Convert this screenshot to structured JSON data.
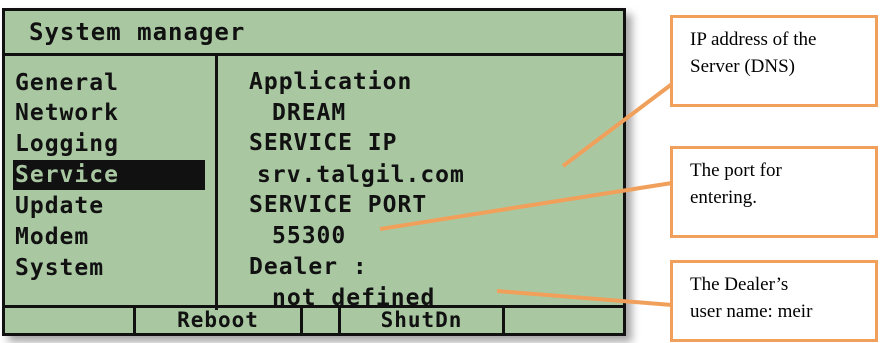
{
  "title": "System manager",
  "menu": {
    "items": [
      "General",
      "Network",
      "Logging",
      "Service",
      "Update",
      "Modem",
      "System"
    ],
    "selected": "Service"
  },
  "content": {
    "lines": [
      "Application",
      "DREAM",
      "SERVICE IP",
      "srv.talgil.com",
      "SERVICE PORT",
      "55300",
      "Dealer :",
      "not defined"
    ]
  },
  "softkeys": [
    "",
    "Reboot",
    "",
    "ShutDn",
    ""
  ],
  "callouts": [
    {
      "line1": "IP address of the",
      "line2": "Server (DNS)"
    },
    {
      "line1": "The port for",
      "line2": "entering."
    },
    {
      "line1": "The Dealer’s",
      "line2": "user name: meir"
    }
  ],
  "colors": {
    "lcd_background": "#a9c8a2",
    "lcd_ink": "#111111",
    "callout_accent": "#f0a05a"
  }
}
